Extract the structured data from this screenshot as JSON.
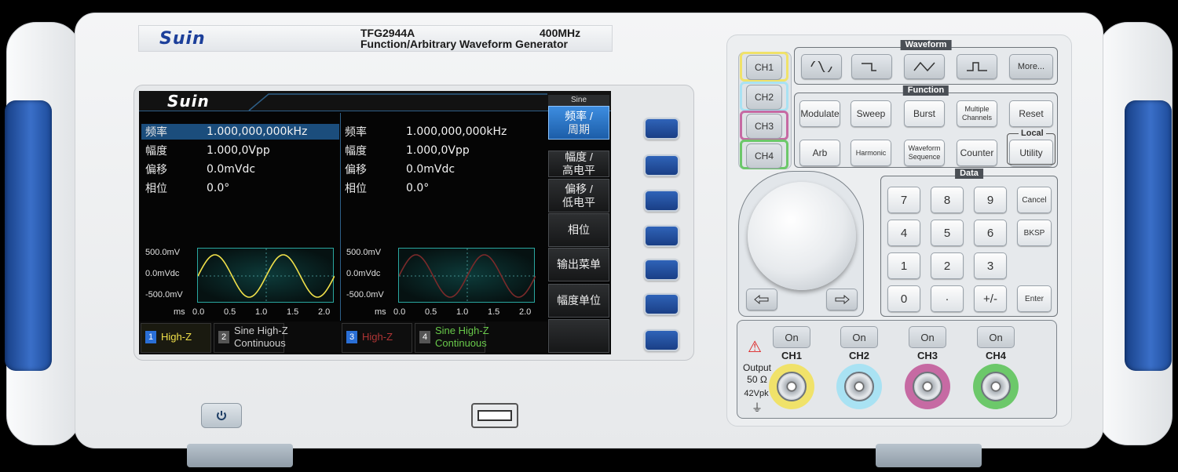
{
  "brand": {
    "logo": "Suin"
  },
  "model": {
    "name": "TFG2944A",
    "freq": "400MHz",
    "desc": "Function/Arbitrary Waveform Generator"
  },
  "screen": {
    "menu_title": "Sine",
    "params": {
      "ch1": [
        {
          "label": "频率",
          "value": "1.000,000,000kHz"
        },
        {
          "label": "幅度",
          "value": "1.000,0Vpp"
        },
        {
          "label": "偏移",
          "value": "0.0mVdc"
        },
        {
          "label": "相位",
          "value": "0.0°"
        }
      ],
      "ch2": [
        {
          "label": "频率",
          "value": "1.000,000,000kHz"
        },
        {
          "label": "幅度",
          "value": "1.000,0Vpp"
        },
        {
          "label": "偏移",
          "value": "0.0mVdc"
        },
        {
          "label": "相位",
          "value": "0.0°"
        }
      ]
    },
    "plot": {
      "ylabels": [
        "500.0mV",
        "0.0mVdc",
        "-500.0mV"
      ],
      "xunit": "ms",
      "xticks": [
        "0.0",
        "0.5",
        "1.0",
        "1.5",
        "2.0"
      ]
    },
    "ch_status": [
      {
        "num": "1",
        "text1": "High-Z",
        "text2": ""
      },
      {
        "num": "2",
        "text1": "Sine High-Z",
        "text2": "Continuous"
      },
      {
        "num": "3",
        "text1": "High-Z",
        "text2": ""
      },
      {
        "num": "4",
        "text1": "Sine High-Z",
        "text2": "Continuous"
      }
    ],
    "softmenu": [
      {
        "l1": "频率 /",
        "l2": "周期"
      },
      {
        "l1": "幅度 /",
        "l2": "高电平"
      },
      {
        "l1": "偏移 /",
        "l2": "低电平"
      },
      {
        "l1": "相位",
        "l2": ""
      },
      {
        "l1": "输出菜单",
        "l2": ""
      },
      {
        "l1": "幅度单位",
        "l2": ""
      },
      {
        "l1": "",
        "l2": ""
      }
    ],
    "colors": {
      "ch1": "#f0e04a",
      "ch2": "#7a2a2a",
      "ch3": "#b03535",
      "ch4": "#68c94a",
      "accent": "#1b4d7c"
    }
  },
  "panel": {
    "channels": [
      "CH1",
      "CH2",
      "CH3",
      "CH4"
    ],
    "waveform_title": "Waveform",
    "waveform_more": "More...",
    "function_title": "Function",
    "function_keys": [
      [
        "Modulate",
        "Sweep",
        "Burst",
        "Multiple Channels",
        "Reset"
      ],
      [
        "Arb",
        "Harmonic",
        "Waveform Sequence",
        "Counter",
        "Utility"
      ]
    ],
    "local_label": "Local",
    "data_title": "Data",
    "numpad": [
      [
        "7",
        "8",
        "9",
        "Cancel"
      ],
      [
        "4",
        "5",
        "6",
        "BKSP"
      ],
      [
        "1",
        "2",
        "3",
        ""
      ],
      [
        "0",
        "·",
        "+/-",
        "Enter"
      ]
    ],
    "on_label": "On",
    "output_ch": [
      "CH1",
      "CH2",
      "CH3",
      "CH4"
    ],
    "output_label": "Output",
    "output_imp": "50 Ω",
    "output_max": "42Vpk"
  }
}
